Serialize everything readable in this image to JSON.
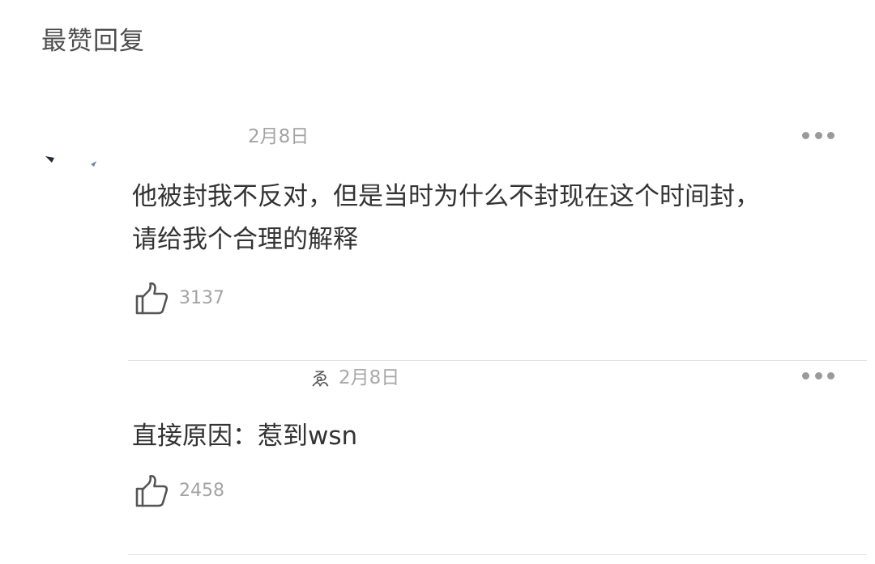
{
  "section": {
    "title": "最赞回复"
  },
  "comments": [
    {
      "date": "2月8日",
      "text_lines": [
        "他被封我不反对，但是当时为什么不封现在这个时间封，",
        "请给我个合理的解释"
      ],
      "like_count": "3137",
      "like_icon": "thumbs-up-icon",
      "more_icon": "more-dots-icon"
    },
    {
      "user_glyph": "ゑ",
      "date": "2月8日",
      "text_lines": [
        "直接原因：惹到wsn"
      ],
      "like_count": "2458",
      "like_icon": "thumbs-up-icon",
      "more_icon": "more-dots-icon"
    }
  ],
  "colors": {
    "text": "#333333",
    "meta": "#a3a3a3",
    "divider": "#e3e3e3",
    "dots": "#9a9a9a"
  }
}
